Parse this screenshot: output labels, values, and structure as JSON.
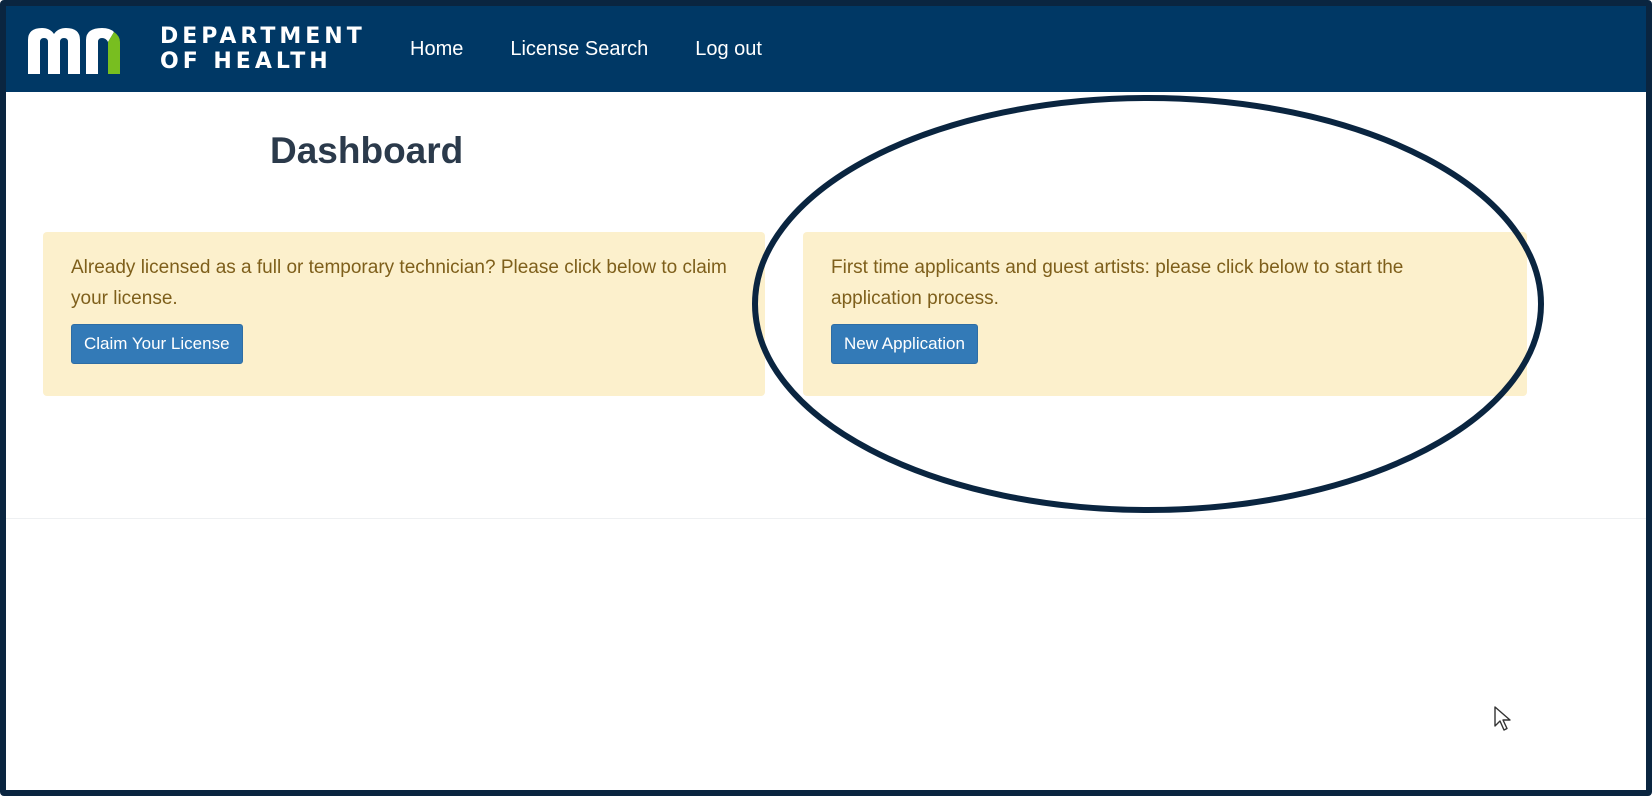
{
  "header": {
    "logo_line1": "DEPARTMENT",
    "logo_line2": "OF HEALTH",
    "nav": [
      {
        "label": "Home"
      },
      {
        "label": "License Search"
      },
      {
        "label": "Log out"
      }
    ]
  },
  "main": {
    "title": "Dashboard",
    "cards": [
      {
        "text": "Already licensed as a full or temporary technician? Please click below to claim your license.",
        "button": "Claim Your License"
      },
      {
        "text": "First time applicants and guest artists: please click below to start the application process.",
        "button": "New Application"
      }
    ]
  },
  "colors": {
    "navbar": "#003865",
    "card_bg": "#fcf0cc",
    "card_text": "#7e5f1b",
    "button": "#337ab7",
    "logo_green": "#78be20",
    "highlight_ring": "#0a2540"
  },
  "icons": [
    "mn-logo-icon",
    "cursor-pointer-icon"
  ]
}
